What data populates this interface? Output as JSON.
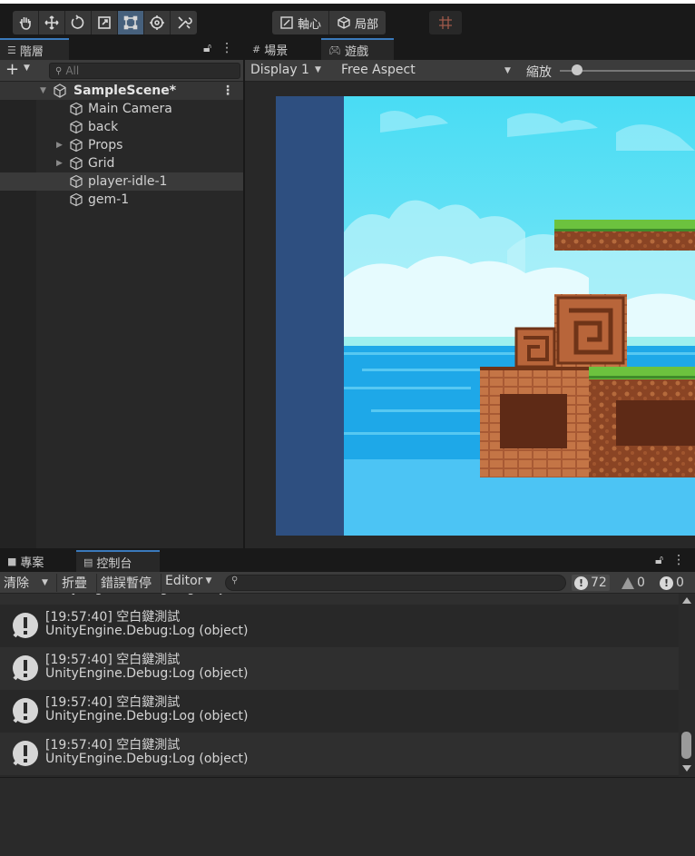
{
  "toolbar": {
    "tools": [
      "hand-icon",
      "move-icon",
      "rotate-icon",
      "scale-icon",
      "rect-tool-icon",
      "transform-icon",
      "custom-tool-icon"
    ],
    "active_tool": "rect-tool-icon",
    "pivot_label": "軸心",
    "local_label": "局部"
  },
  "hierarchy": {
    "tab_label": "階層",
    "search_placeholder": "All",
    "scene_name": "SampleScene*",
    "items": [
      {
        "label": "Main Camera",
        "expandable": false
      },
      {
        "label": "back",
        "expandable": false
      },
      {
        "label": "Props",
        "expandable": true
      },
      {
        "label": "Grid",
        "expandable": true
      },
      {
        "label": "player-idle-1",
        "expandable": false,
        "selected": true
      },
      {
        "label": "gem-1",
        "expandable": false
      }
    ]
  },
  "scene_tab": {
    "label": "場景"
  },
  "game": {
    "tab_label": "遊戲",
    "display": "Display 1",
    "aspect": "Free Aspect",
    "zoom_label": "縮放",
    "zoom_level": 0.12
  },
  "project_tab": {
    "label": "專案"
  },
  "console": {
    "tab_label": "控制台",
    "clear_label": "清除",
    "collapse_label": "折疊",
    "error_pause_label": "錯誤暫停",
    "editor_label": "Editor",
    "log_count": "72",
    "warn_count": "0",
    "error_count": "0",
    "entries": [
      {
        "time": "[19:57:40] 空白鍵測試",
        "detail": "UnityEngine.Debug:Log (object)"
      },
      {
        "time": "[19:57:40] 空白鍵測試",
        "detail": "UnityEngine.Debug:Log (object)"
      },
      {
        "time": "[19:57:40] 空白鍵測試",
        "detail": "UnityEngine.Debug:Log (object)"
      },
      {
        "time": "[19:57:40] 空白鍵測試",
        "detail": "UnityEngine.Debug:Log (object)"
      }
    ]
  },
  "colors": {
    "accent": "#3a79bb",
    "active_tool": "#46607c",
    "sky": "#4fd6f4",
    "water": "#1ea8e8",
    "grass": "#6cc23e",
    "stone": "#b8653a",
    "game_border": "#2e4f80"
  }
}
